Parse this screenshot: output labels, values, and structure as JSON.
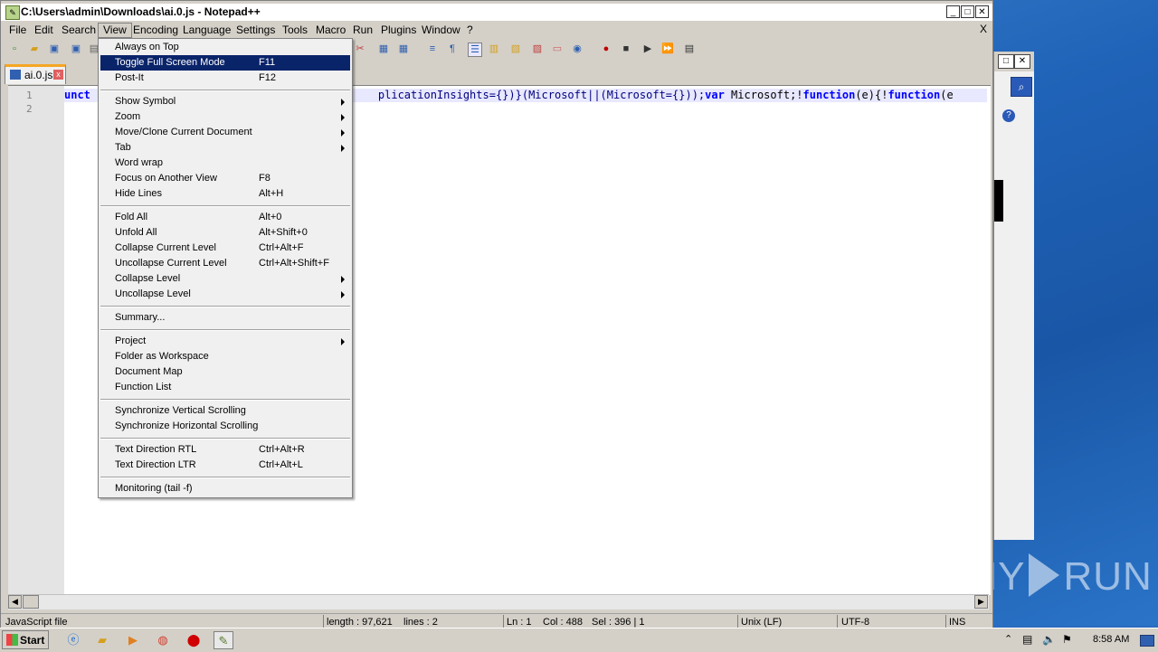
{
  "window": {
    "title": "C:\\Users\\admin\\Downloads\\ai.0.js - Notepad++",
    "minimize": "_",
    "maximize": "□",
    "close": "✕"
  },
  "menubar": {
    "items": [
      "File",
      "Edit",
      "Search",
      "View",
      "Encoding",
      "Language",
      "Settings",
      "Tools",
      "Macro",
      "Run",
      "Plugins",
      "Window",
      "?"
    ],
    "active": "View",
    "close_doc": "X"
  },
  "tab": {
    "label": "ai.0.js",
    "close": "x"
  },
  "editor": {
    "line_numbers": [
      "1",
      "2"
    ],
    "code_kw1": "unct",
    "code_mid": "plicationInsights={})}(Microsoft||(Microsoft={}));",
    "code_kw2": "var",
    "code_rest": " Microsoft;!",
    "code_kw3": "function",
    "code_rest2": "(e){!",
    "code_kw4": "function",
    "code_tail": "(e"
  },
  "view_menu": {
    "groups": [
      [
        {
          "label": "Always on Top",
          "shortcut": ""
        },
        {
          "label": "Toggle Full Screen Mode",
          "shortcut": "F11",
          "highlighted": true
        },
        {
          "label": "Post-It",
          "shortcut": "F12"
        }
      ],
      [
        {
          "label": "Show Symbol",
          "shortcut": "",
          "submenu": true
        },
        {
          "label": "Zoom",
          "shortcut": "",
          "submenu": true
        },
        {
          "label": "Move/Clone Current Document",
          "shortcut": "",
          "submenu": true
        },
        {
          "label": "Tab",
          "shortcut": "",
          "submenu": true
        },
        {
          "label": "Word wrap",
          "shortcut": ""
        },
        {
          "label": "Focus on Another View",
          "shortcut": "F8"
        },
        {
          "label": "Hide Lines",
          "shortcut": "Alt+H"
        }
      ],
      [
        {
          "label": "Fold All",
          "shortcut": "Alt+0"
        },
        {
          "label": "Unfold All",
          "shortcut": "Alt+Shift+0"
        },
        {
          "label": "Collapse Current Level",
          "shortcut": "Ctrl+Alt+F"
        },
        {
          "label": "Uncollapse Current Level",
          "shortcut": "Ctrl+Alt+Shift+F"
        },
        {
          "label": "Collapse Level",
          "shortcut": "",
          "submenu": true
        },
        {
          "label": "Uncollapse Level",
          "shortcut": "",
          "submenu": true
        }
      ],
      [
        {
          "label": "Summary...",
          "shortcut": ""
        }
      ],
      [
        {
          "label": "Project",
          "shortcut": "",
          "submenu": true
        },
        {
          "label": "Folder as Workspace",
          "shortcut": ""
        },
        {
          "label": "Document Map",
          "shortcut": ""
        },
        {
          "label": "Function List",
          "shortcut": ""
        }
      ],
      [
        {
          "label": "Synchronize Vertical Scrolling",
          "shortcut": ""
        },
        {
          "label": "Synchronize Horizontal Scrolling",
          "shortcut": ""
        }
      ],
      [
        {
          "label": "Text Direction RTL",
          "shortcut": "Ctrl+Alt+R"
        },
        {
          "label": "Text Direction LTR",
          "shortcut": "Ctrl+Alt+L"
        }
      ],
      [
        {
          "label": "Monitoring (tail -f)",
          "shortcut": ""
        }
      ]
    ]
  },
  "statusbar": {
    "file_type": "JavaScript file",
    "length": "length : 97,621",
    "lines": "lines : 2",
    "ln": "Ln : 1",
    "col": "Col : 488",
    "sel": "Sel : 396 | 1",
    "eol": "Unix (LF)",
    "encoding": "UTF-8",
    "mode": "INS"
  },
  "taskbar": {
    "start": "Start",
    "clock": "8:58 AM"
  },
  "watermark": {
    "left": "ANY",
    "right": "RUN"
  },
  "colors": {
    "highlight": "#0a246a",
    "keyword": "#0000ff",
    "tab_accent": "#f5a623"
  }
}
